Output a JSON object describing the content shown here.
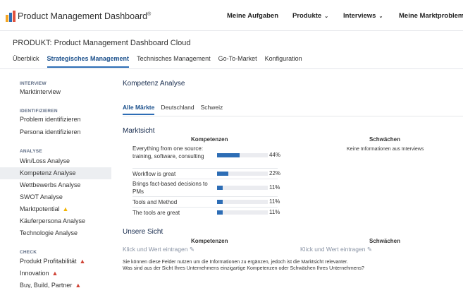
{
  "header": {
    "brand": "Product Management Dashboard",
    "trademark": "®",
    "nav": [
      {
        "label": "Meine Aufgaben",
        "dropdown": false
      },
      {
        "label": "Produkte",
        "dropdown": true
      },
      {
        "label": "Interviews",
        "dropdown": true
      },
      {
        "label": "Meine Marktprobleme",
        "dropdown": false
      }
    ]
  },
  "project": {
    "title": "PRODUKT: Product Management Dashboard Cloud",
    "tabs": [
      {
        "label": "Überblick",
        "active": false
      },
      {
        "label": "Strategisches Management",
        "active": true
      },
      {
        "label": "Technisches Management",
        "active": false
      },
      {
        "label": "Go-To-Market",
        "active": false
      },
      {
        "label": "Konfiguration",
        "active": false
      }
    ]
  },
  "sidebar": {
    "sections": [
      {
        "title": "INTERVIEW",
        "items": [
          {
            "label": "Marktinterview"
          }
        ]
      },
      {
        "title": "IDENTIFIZIEREN",
        "items": [
          {
            "label": "Problem identifizieren"
          },
          {
            "label": "Persona identifizieren"
          }
        ]
      },
      {
        "title": "ANALYSE",
        "items": [
          {
            "label": "Win/Loss Analyse"
          },
          {
            "label": "Kompetenz Analyse",
            "active": true
          },
          {
            "label": "Wettbewerbs Analyse"
          },
          {
            "label": "SWOT Analyse"
          },
          {
            "label": "Marktpotential",
            "warning": "yellow"
          },
          {
            "label": "Käuferpersona Analyse"
          },
          {
            "label": "Technologie Analyse"
          }
        ]
      },
      {
        "title": "CHECK",
        "items": [
          {
            "label": "Produkt Profitabilität",
            "warning": "red"
          },
          {
            "label": "Innovation",
            "warning": "red"
          },
          {
            "label": "Buy, Build, Partner",
            "warning": "red"
          }
        ]
      }
    ]
  },
  "main": {
    "title": "Kompetenz Analyse",
    "subtabs": [
      {
        "label": "Alle Märkte",
        "active": true
      },
      {
        "label": "Deutschland",
        "active": false
      },
      {
        "label": "Schweiz",
        "active": false
      }
    ],
    "marktsicht": {
      "title": "Marktsicht",
      "kompetenzen_header": "Kompetenzen",
      "schwaechen_header": "Schwächen",
      "rows": [
        {
          "label": "Everything from one source: training, software, consulting",
          "percent": 44,
          "percent_text": "44%"
        },
        {
          "label": "Workflow is great",
          "percent": 22,
          "percent_text": "22%"
        },
        {
          "label": "Brings fact-based decisions to PMs",
          "percent": 11,
          "percent_text": "11%"
        },
        {
          "label": "Tools and Method",
          "percent": 11,
          "percent_text": "11%"
        },
        {
          "label": "The tools are great",
          "percent": 11,
          "percent_text": "11%"
        }
      ],
      "schwaechen_empty": "Keine Informationen aus Interviews"
    },
    "unsere_sicht": {
      "title": "Unsere Sicht",
      "kompetenzen_header": "Kompetenzen",
      "schwaechen_header": "Schwächen",
      "kompetenzen_placeholder": "Klick und Wert eintragen",
      "schwaechen_placeholder": "Klick und Wert eintragen",
      "note_line1": "Sie können diese Felder nutzen um die Informationen zu ergänzen, jedoch ist die Marktsicht relevanter.",
      "note_line2": "Was sind aus der Sicht Ihres Unternehmens einzigartige Kompetenzen oder Schwächen Ihres Unternehmens?"
    }
  },
  "colors": {
    "accent": "#2d6db5",
    "active_tab_text": "#1a4f8b",
    "warning_yellow": "#f4b400",
    "warning_red": "#d04437"
  }
}
